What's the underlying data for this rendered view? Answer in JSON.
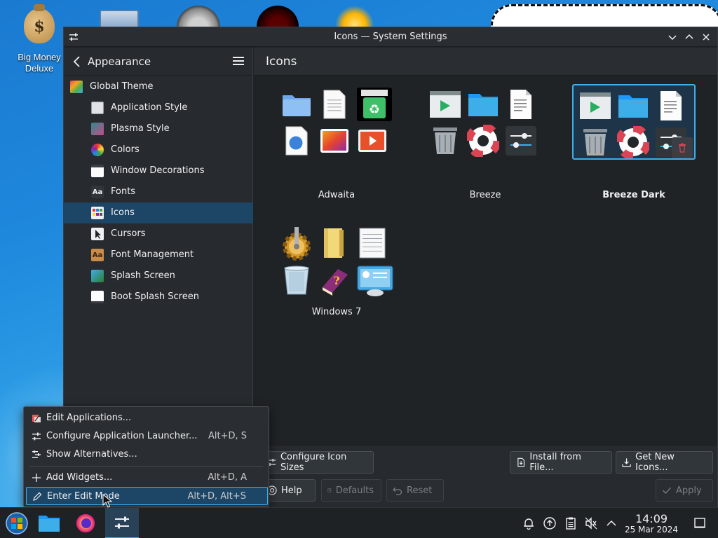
{
  "desktop": {
    "icon_label": "Big Money Deluxe",
    "icon_symbol": "$"
  },
  "window": {
    "title": "Icons — System Settings",
    "controls": [
      "minimize",
      "maximize",
      "close"
    ]
  },
  "sidebar": {
    "header": "Appearance",
    "items": [
      {
        "label": "Global Theme",
        "icon": "global-theme-icon"
      },
      {
        "label": "Application Style",
        "icon": "application-style-icon"
      },
      {
        "label": "Plasma Style",
        "icon": "plasma-style-icon"
      },
      {
        "label": "Colors",
        "icon": "colors-icon"
      },
      {
        "label": "Window Decorations",
        "icon": "window-decorations-icon"
      },
      {
        "label": "Fonts",
        "icon": "fonts-icon"
      },
      {
        "label": "Icons",
        "icon": "icons-icon",
        "selected": true
      },
      {
        "label": "Cursors",
        "icon": "cursors-icon"
      },
      {
        "label": "Font Management",
        "icon": "font-management-icon"
      },
      {
        "label": "Splash Screen",
        "icon": "splash-screen-icon"
      },
      {
        "label": "Boot Splash Screen",
        "icon": "boot-splash-icon"
      }
    ]
  },
  "content": {
    "title": "Icons",
    "themes": [
      {
        "name": "Adwaita"
      },
      {
        "name": "Breeze"
      },
      {
        "name": "Breeze Dark",
        "selected": true
      },
      {
        "name": "Windows 7"
      }
    ]
  },
  "buttons": {
    "configure_sizes": "Configure Icon Sizes",
    "install_file": "Install from File...",
    "get_new": "Get New Icons...",
    "help": "Help",
    "defaults": "Defaults",
    "reset": "Reset",
    "apply": "Apply"
  },
  "context_menu": {
    "items": [
      {
        "label": "Edit Applications...",
        "shortcut": ""
      },
      {
        "label": "Configure Application Launcher...",
        "shortcut": "Alt+D, S"
      },
      {
        "label": "Show Alternatives...",
        "shortcut": ""
      },
      {
        "label": "Add Widgets...",
        "shortcut": "Alt+D, A"
      },
      {
        "label": "Enter Edit Mode",
        "shortcut": "Alt+D, Alt+S",
        "selected": true
      }
    ]
  },
  "taskbar": {
    "time": "14:09",
    "date": "25 Mar 2024"
  },
  "colors": {
    "accent": "#3daee9",
    "selection": "#1d4566",
    "window_bg": "#202326"
  }
}
